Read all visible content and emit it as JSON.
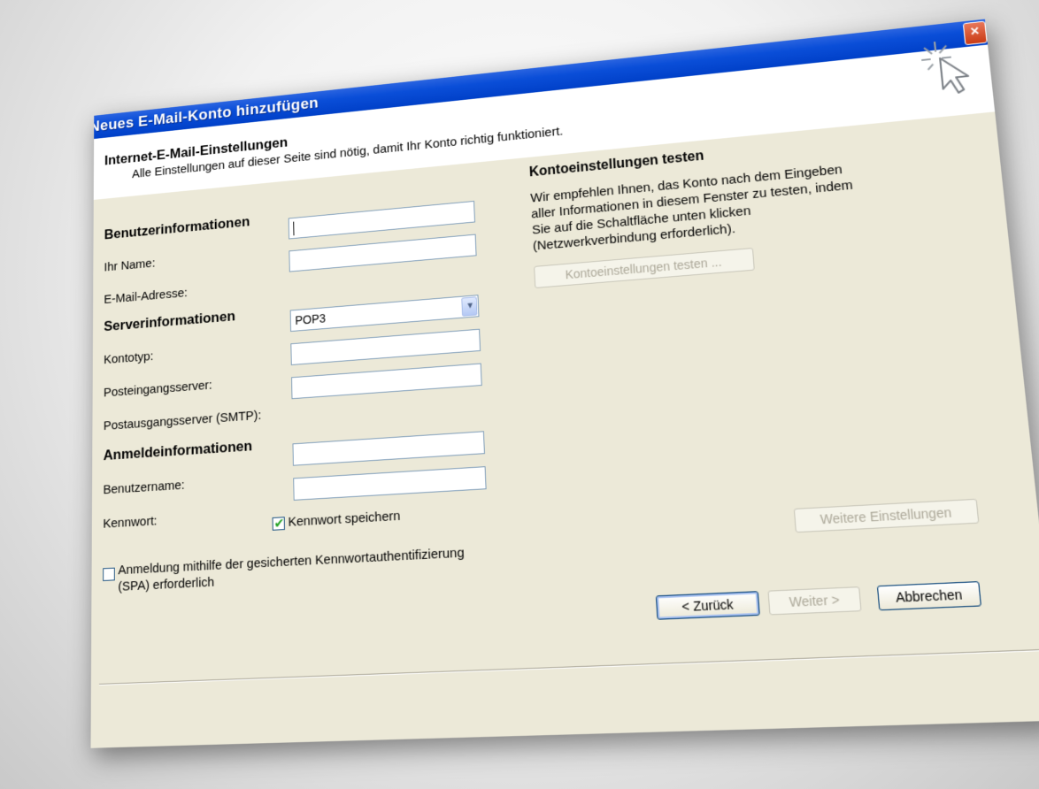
{
  "window": {
    "title": "Neues E-Mail-Konto hinzufügen",
    "close_symbol": "×"
  },
  "header": {
    "title": "Internet-E-Mail-Einstellungen",
    "subtitle": "Alle Einstellungen auf dieser Seite sind nötig, damit Ihr Konto richtig funktioniert.",
    "icon": "cursor-sparkle-icon"
  },
  "user_info": {
    "section_title": "Benutzerinformationen",
    "name_label": "Ihr Name:",
    "name_value": "",
    "email_label": "E-Mail-Adresse:",
    "email_value": ""
  },
  "server_info": {
    "section_title": "Serverinformationen",
    "account_type_label": "Kontotyp:",
    "account_type_value": "POP3",
    "incoming_label": "Posteingangsserver:",
    "incoming_value": "",
    "outgoing_label": "Postausgangsserver (SMTP):",
    "outgoing_value": ""
  },
  "login_info": {
    "section_title": "Anmeldeinformationen",
    "username_label": "Benutzername:",
    "username_value": "",
    "password_label": "Kennwort:",
    "password_value": "",
    "save_password_label": "Kennwort speichern",
    "save_password_checked": true,
    "spa_label_line1": "Anmeldung mithilfe der gesicherten Kennwortauthentifizierung",
    "spa_label_line2": "(SPA) erforderlich",
    "spa_checked": false
  },
  "test_settings": {
    "title": "Kontoeinstellungen testen",
    "description_line1": "Wir empfehlen Ihnen, das Konto nach dem Eingeben",
    "description_line2": "aller Informationen in diesem Fenster zu testen, indem",
    "description_line3": "Sie auf die Schaltfläche unten klicken",
    "description_line4": "(Netzwerkverbindung erforderlich).",
    "test_button_label": "Kontoeinstellungen testen ..."
  },
  "buttons": {
    "more_settings_label": "Weitere Einstellungen",
    "back_label": "< Zurück",
    "next_label": "Weiter >",
    "cancel_label": "Abbrechen"
  },
  "colors": {
    "title_bar": "#0a4ed8",
    "dialog_body": "#ece9d8",
    "input_border": "#7f9db9",
    "checkmark": "#21a121",
    "disabled_text": "#aca899"
  }
}
